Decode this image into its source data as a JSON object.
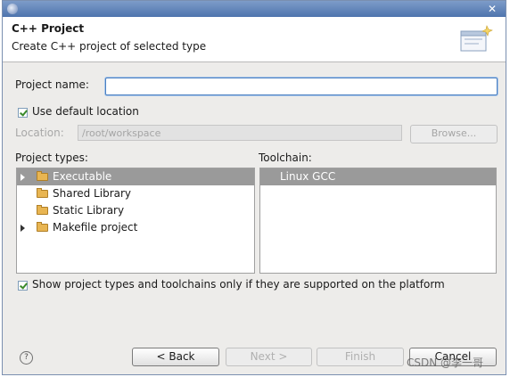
{
  "window": {
    "close_glyph": "✕"
  },
  "banner": {
    "title": "C++ Project",
    "description": "Create C++ project of selected type",
    "icon": "new-project-wizard-icon"
  },
  "form": {
    "project_name_label": "Project name:",
    "project_name_value": "",
    "use_default_location_label": "Use default location",
    "use_default_location_checked": true,
    "location_label": "Location:",
    "location_value": "/root/workspace",
    "browse_label": "Browse..."
  },
  "project_types": {
    "label": "Project types:",
    "items": [
      {
        "label": "Executable",
        "expandable": true,
        "selected": true
      },
      {
        "label": "Shared Library",
        "expandable": false,
        "selected": false
      },
      {
        "label": "Static Library",
        "expandable": false,
        "selected": false
      },
      {
        "label": "Makefile project",
        "expandable": true,
        "selected": false
      }
    ]
  },
  "toolchain": {
    "label": "Toolchain:",
    "items": [
      {
        "label": "Linux GCC",
        "selected": true
      }
    ]
  },
  "filter": {
    "label": "Show project types and toolchains only if they are supported on the platform",
    "checked": true
  },
  "buttons": {
    "help": "?",
    "back": "< Back",
    "next": "Next >",
    "finish": "Finish",
    "cancel": "Cancel"
  },
  "watermark": "CSDN @李一哥",
  "colors": {
    "title_bar": "#5a7fb6",
    "selection": "#9a9a9a",
    "focus_border": "#4a7fc1"
  }
}
